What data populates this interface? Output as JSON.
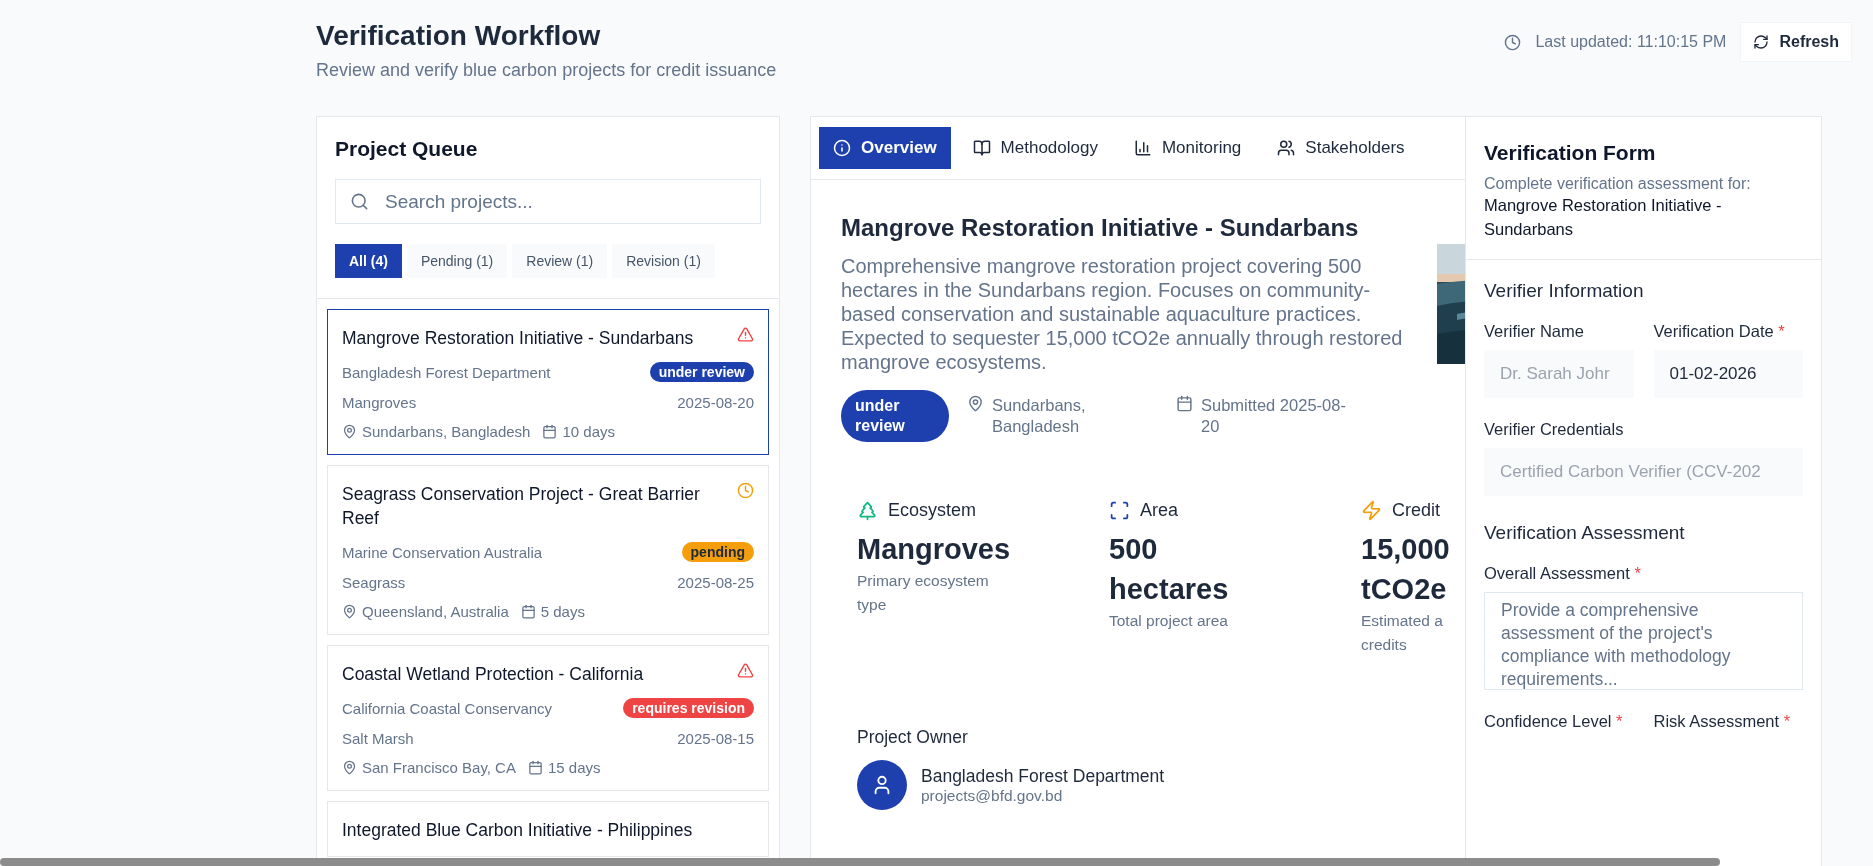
{
  "header": {
    "title": "Verification Workflow",
    "subtitle": "Review and verify blue carbon projects for credit issuance",
    "last_updated": "Last updated: 11:10:15 PM",
    "refresh_button": "Refresh"
  },
  "queue": {
    "title": "Project Queue",
    "search": {
      "placeholder": "Search projects..."
    },
    "filters": [
      {
        "label": "All (4)",
        "selected": true
      },
      {
        "label": "Pending (1)",
        "selected": false
      },
      {
        "label": "Review (1)",
        "selected": false
      },
      {
        "label": "Revision (1)",
        "selected": false
      }
    ],
    "projects": [
      {
        "title": "Mangrove Restoration Initiative - Sundarbans",
        "kind": "warning",
        "organization": "Bangladesh Forest Department",
        "status": {
          "label": "under review",
          "kind": "review"
        },
        "ecosystem": "Mangroves",
        "date": "2025-08-20",
        "location": "Sundarbans, Bangladesh",
        "duration": "10 days",
        "selected": true
      },
      {
        "title": "Seagrass Conservation Project - Great Barrier Reef",
        "kind": "clock",
        "organization": "Marine Conservation Australia",
        "status": {
          "label": "pending",
          "kind": "pending"
        },
        "ecosystem": "Seagrass",
        "date": "2025-08-25",
        "location": "Queensland, Australia",
        "duration": "5 days",
        "selected": false
      },
      {
        "title": "Coastal Wetland Protection - California",
        "kind": "warning",
        "organization": "California Coastal Conservancy",
        "status": {
          "label": "requires revision",
          "kind": "revision"
        },
        "ecosystem": "Salt Marsh",
        "date": "2025-08-15",
        "location": "San Francisco Bay, CA",
        "duration": "15 days",
        "selected": false
      },
      {
        "title": "Integrated Blue Carbon Initiative - Philippines",
        "selected": false
      }
    ]
  },
  "detail": {
    "tabs": [
      {
        "label": "Overview",
        "kind": "info",
        "selected": true
      },
      {
        "label": "Methodology",
        "kind": "book",
        "selected": false
      },
      {
        "label": "Monitoring",
        "kind": "chart",
        "selected": false
      },
      {
        "label": "Stakeholders",
        "kind": "users",
        "selected": false
      }
    ],
    "title": "Mangrove Restoration Initiative - Sundarbans",
    "description": "Comprehensive mangrove restoration project covering 500 hectares in the Sundarbans region. Focuses on community-based conservation and sustainable aquaculture practices. Expected to sequester 15,000 tCO2e annually through restored mangrove ecosystems.",
    "status": {
      "label": "under review",
      "kind": "review"
    },
    "location": "Sundarbans, Bangladesh",
    "submitted": "Submitted 2025-08-20",
    "stats": [
      {
        "label": "Ecosystem",
        "kind": "tree",
        "value": "Mangroves",
        "caption": "Primary ecosystem type"
      },
      {
        "label": "Area",
        "kind": "scan",
        "value": "500 hectares",
        "caption": "Total project area"
      },
      {
        "label": "Credit",
        "kind": "zap",
        "value": "15,000 tCO2e",
        "caption": "Estimated a credits"
      }
    ],
    "owner": {
      "heading": "Project Owner",
      "name": "Bangladesh Forest Department",
      "email": "projects@bfd.gov.bd"
    }
  },
  "form": {
    "title": "Verification Form",
    "intro": "Complete verification assessment for:",
    "project": "Mangrove Restoration Initiative - Sundarbans",
    "sections": [
      {
        "title": "Verifier Information"
      },
      {
        "title": "Verification Assessment"
      }
    ],
    "verifier_name": {
      "label": "Verifier Name",
      "placeholder": "Dr. Sarah Johr"
    },
    "verification_date": {
      "label": "Verification Date",
      "mark": "*",
      "value": "01-02-2026"
    },
    "credentials": {
      "label": "Verifier Credentials",
      "placeholder": "Certified Carbon Verifier (CCV-202"
    },
    "overall": {
      "label": "Overall Assessment",
      "mark": "*",
      "placeholder": "Provide a comprehensive assessment of the project's compliance with methodology requirements..."
    },
    "confidence": {
      "label": "Confidence Level",
      "mark": "*"
    },
    "risk": {
      "label": "Risk Assessment",
      "mark": "*"
    }
  }
}
